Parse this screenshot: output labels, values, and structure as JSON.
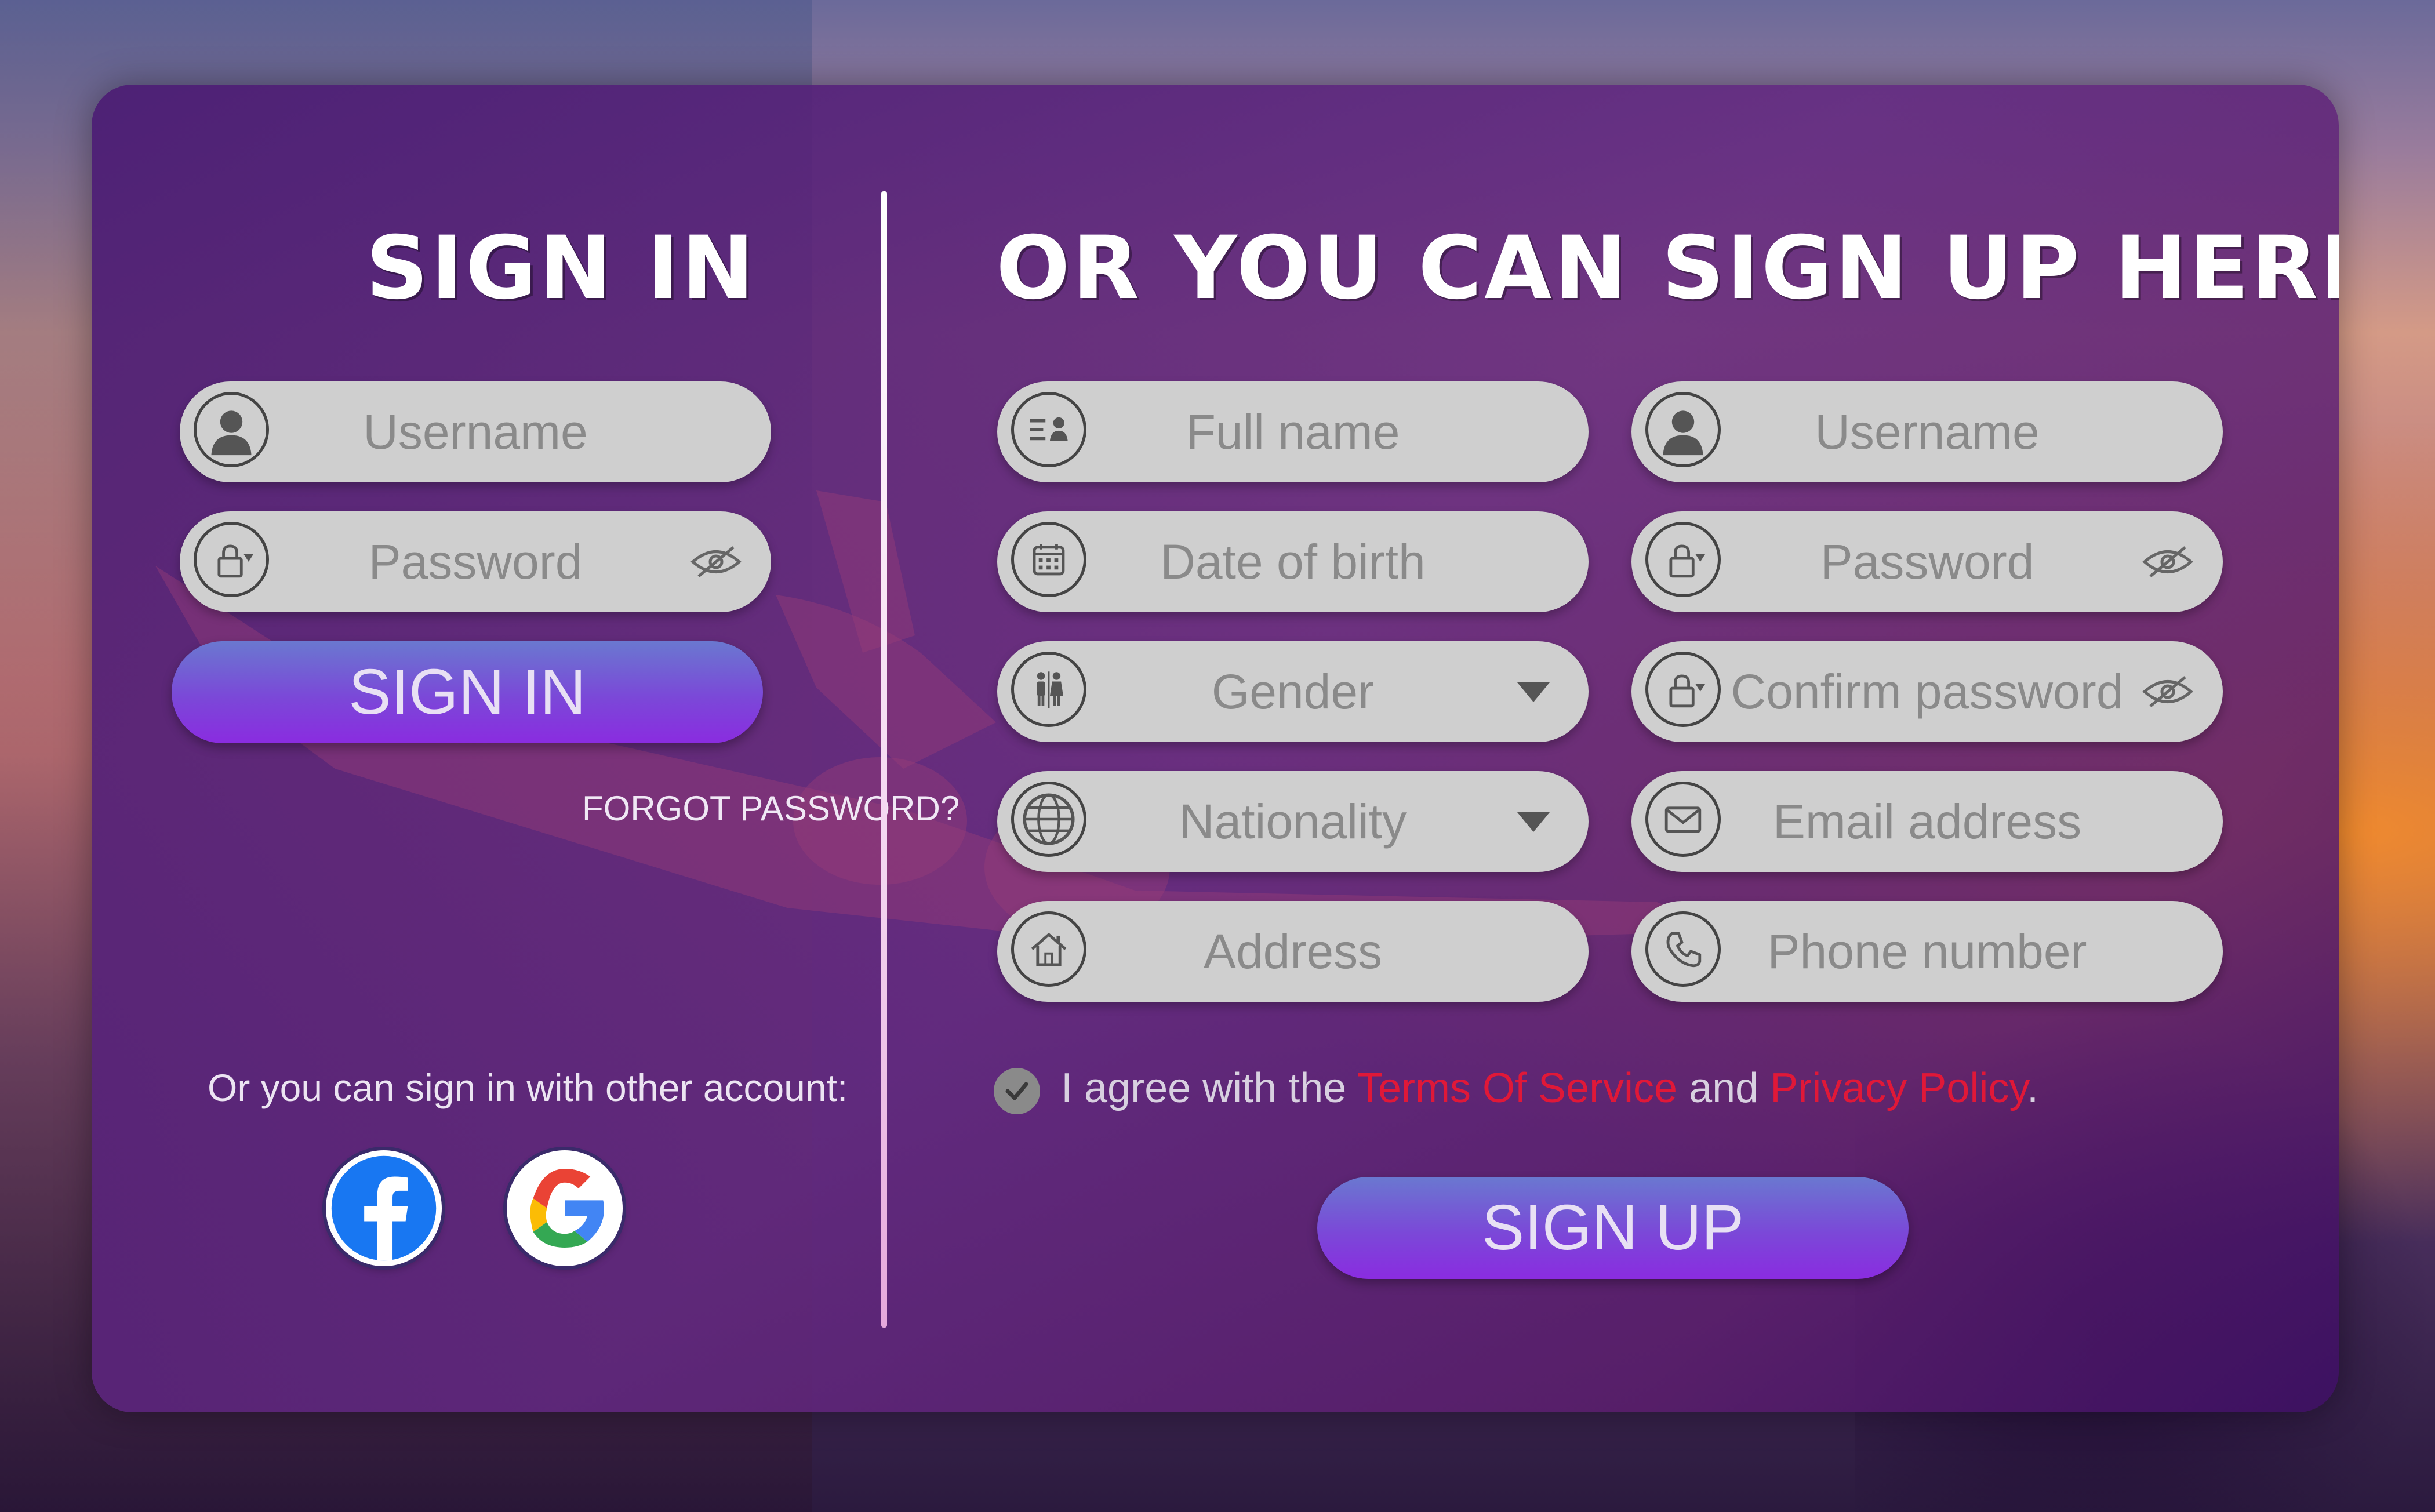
{
  "signin": {
    "title": "SIGN IN",
    "username_placeholder": "Username",
    "password_placeholder": "Password",
    "button_label": "SIGN IN",
    "forgot_label": "FORGOT PASSWORD?",
    "other_account_text": "Or you can sign in with other account:",
    "social": [
      "facebook-icon",
      "google-icon"
    ]
  },
  "signup": {
    "title": "OR YOU CAN SIGN UP HERE",
    "fields": {
      "full_name": "Full name",
      "date_of_birth": "Date of birth",
      "gender": "Gender",
      "nationality": "Nationality",
      "address": "Address",
      "username": "Username",
      "password": "Password",
      "confirm_password": "Confirm password",
      "email": "Email address",
      "phone": "Phone number"
    },
    "agree": {
      "prefix": "I agree with the ",
      "terms": "Terms Of Service",
      "middle": " and ",
      "privacy": "Privacy Policy",
      "suffix": "."
    },
    "button_label": "SIGN UP"
  },
  "colors": {
    "accent": "#7b48d8",
    "link": "#e01838",
    "field_bg": "#cfcfcf",
    "panel": "#5a2280"
  }
}
